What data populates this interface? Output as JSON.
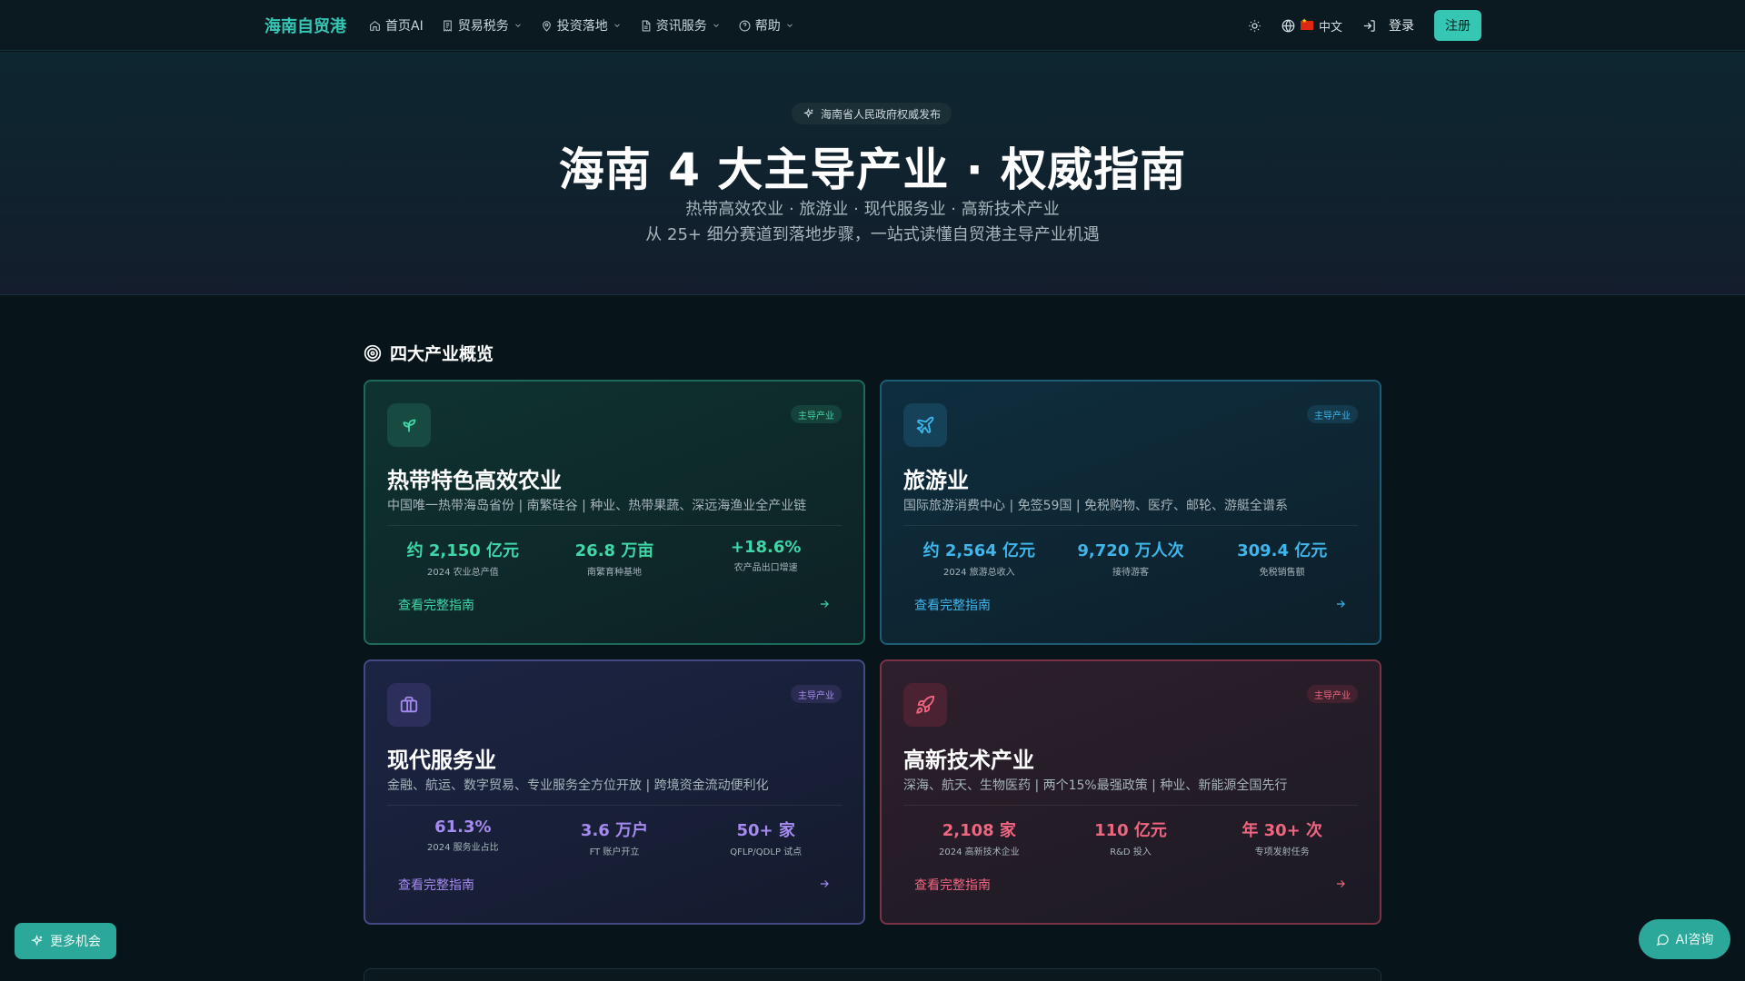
{
  "nav": {
    "brand": "海南自贸港",
    "items": [
      {
        "label": "首页AI",
        "icon": "home-icon",
        "dropdown": false
      },
      {
        "label": "贸易税务",
        "icon": "receipt-icon",
        "dropdown": true
      },
      {
        "label": "投资落地",
        "icon": "map-pin-icon",
        "dropdown": true
      },
      {
        "label": "资讯服务",
        "icon": "file-text-icon",
        "dropdown": true
      },
      {
        "label": "帮助",
        "icon": "help-circle-icon",
        "dropdown": true
      }
    ],
    "language": "中文",
    "login": "登录",
    "signup": "注册"
  },
  "hero": {
    "badge": "海南省人民政府权威发布",
    "title": "海南 4 大主导产业 · 权威指南",
    "subtitle1": "热带高效农业 · 旅游业 · 现代服务业 · 高新技术产业",
    "subtitle2": "从 25+ 细分赛道到落地步骤，一站式读懂自贸港主导产业机遇"
  },
  "section": {
    "title": "四大产业概览"
  },
  "cards": [
    {
      "tag": "主导产业",
      "title": "热带特色高效农业",
      "desc": "中国唯一热带海岛省份 | 南繁硅谷 | 种业、热带果蔬、深远海渔业全产业链",
      "stats": [
        {
          "value": "约 2,150 亿元",
          "label": "2024 农业总产值"
        },
        {
          "value": "26.8 万亩",
          "label": "南繁育种基地"
        },
        {
          "value": "+18.6%",
          "label": "农产品出口增速"
        }
      ],
      "link": "查看完整指南",
      "accent": "#3fd6a8"
    },
    {
      "tag": "主导产业",
      "title": "旅游业",
      "desc": "国际旅游消费中心 | 免签59国 | 免税购物、医疗、邮轮、游艇全谱系",
      "stats": [
        {
          "value": "约 2,564 亿元",
          "label": "2024 旅游总收入"
        },
        {
          "value": "9,720 万人次",
          "label": "接待游客"
        },
        {
          "value": "309.4 亿元",
          "label": "免税销售额"
        }
      ],
      "link": "查看完整指南",
      "accent": "#3fb5ea"
    },
    {
      "tag": "主导产业",
      "title": "现代服务业",
      "desc": "金融、航运、数字贸易、专业服务全方位开放 | 跨境资金流动便利化",
      "stats": [
        {
          "value": "61.3%",
          "label": "2024 服务业占比"
        },
        {
          "value": "3.6 万户",
          "label": "FT 账户开立"
        },
        {
          "value": "50+ 家",
          "label": "QFLP/QDLP 试点"
        }
      ],
      "link": "查看完整指南",
      "accent": "#a58bf0"
    },
    {
      "tag": "主导产业",
      "title": "高新技术产业",
      "desc": "深海、航天、生物医药 | 两个15%最强政策 | 种业、新能源全国先行",
      "stats": [
        {
          "value": "2,108 家",
          "label": "2024 高新技术企业"
        },
        {
          "value": "110 亿元",
          "label": "R&D 投入"
        },
        {
          "value": "年 30+ 次",
          "label": "专项发射任务"
        }
      ],
      "link": "查看完整指南",
      "accent": "#f06580"
    }
  ],
  "floating": {
    "left": "更多机会",
    "right": "AI咨询"
  }
}
